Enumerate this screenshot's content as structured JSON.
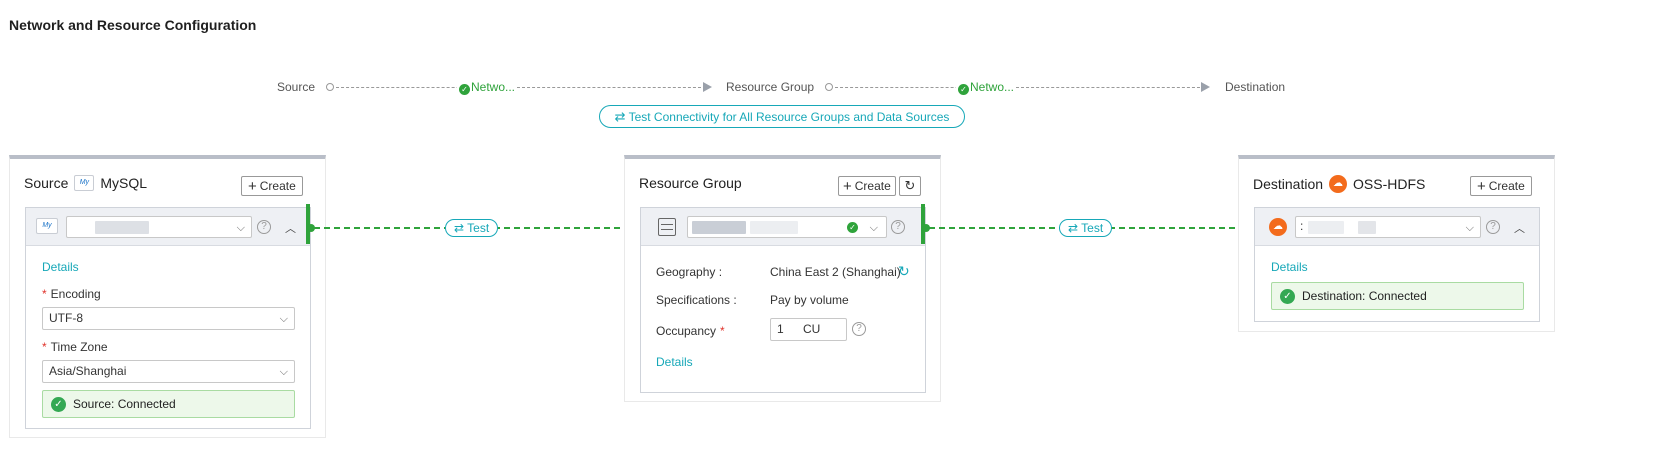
{
  "page": {
    "title": "Network and Resource Configuration"
  },
  "flow": {
    "source_label": "Source",
    "network_label_1": "Netwo...",
    "resource_group_label": "Resource Group",
    "network_label_2": "Netwo...",
    "destination_label": "Destination"
  },
  "test_all": {
    "label": "Test Connectivity for All Resource Groups and Data Sources",
    "icon": "swap-icon"
  },
  "source": {
    "title": "Source",
    "type": "MySQL",
    "create_label": "Create",
    "details_label": "Details",
    "encoding_label": "Encoding",
    "encoding_value": "UTF-8",
    "timezone_label": "Time Zone",
    "timezone_value": "Asia/Shanghai",
    "status": "Source: Connected"
  },
  "resource_group": {
    "title": "Resource Group",
    "create_label": "Create",
    "geography_label": "Geography :",
    "geography_value": "China East 2 (Shanghai)",
    "specifications_label": "Specifications :",
    "specifications_value": "Pay by volume",
    "occupancy_label": "Occupancy",
    "occupancy_value": "1",
    "occupancy_unit": "CU",
    "details_label": "Details"
  },
  "destination": {
    "title": "Destination",
    "type": "OSS-HDFS",
    "create_label": "Create",
    "details_label": "Details",
    "status": "Destination: Connected",
    "select_prefix": ":"
  },
  "connectors": {
    "test_label_1": "Test",
    "test_label_2": "Test"
  },
  "colors": {
    "accent": "#17a8b8",
    "success": "#2fa33b",
    "required": "#e0332b"
  }
}
